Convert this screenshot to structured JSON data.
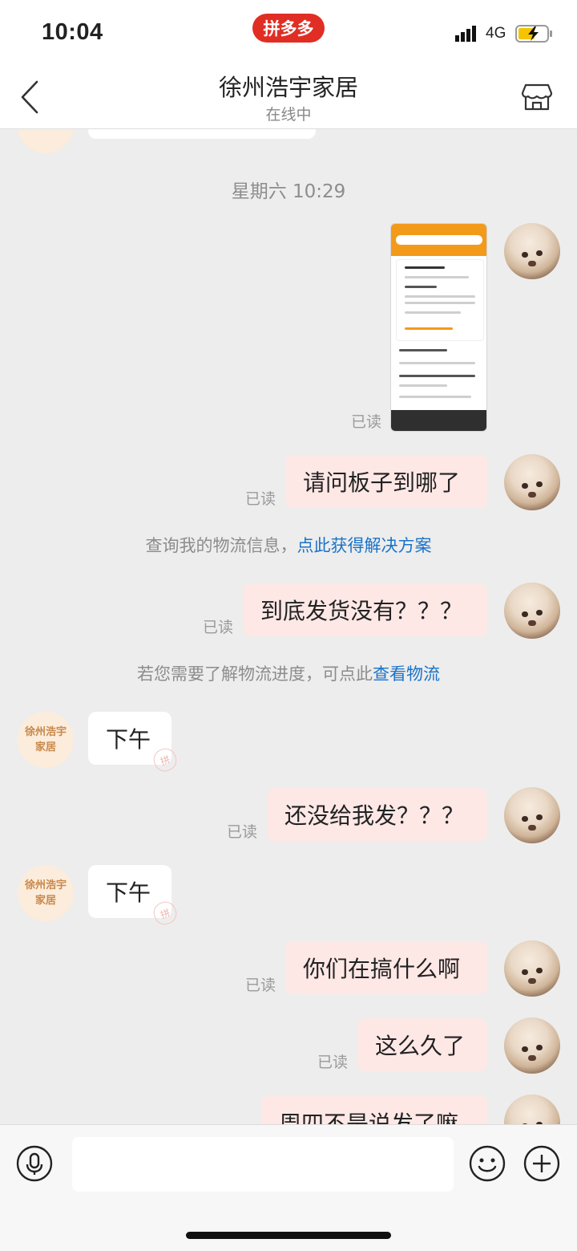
{
  "status_bar": {
    "time": "10:04",
    "app_badge": "拼多多",
    "network": "4G"
  },
  "header": {
    "title": "徐州浩宇家居",
    "subtitle": "在线中"
  },
  "chat": {
    "date_label": "星期六 10:29",
    "read_label": "已读",
    "messages": [
      {
        "text": "请问板子到哪了"
      },
      {
        "text": "到底发货没有？？？"
      },
      {
        "text": "下午"
      },
      {
        "text": "还没给我发？？？"
      },
      {
        "text": "下午"
      },
      {
        "text": "你们在搞什么啊"
      },
      {
        "text": "这么久了"
      },
      {
        "text": "周四不是说发了嘛"
      }
    ],
    "system_notices": [
      {
        "text": "查询我的物流信息，",
        "link": "点此获得解决方案"
      },
      {
        "text": "若您需要了解物流进度，可点此",
        "link": "查看物流"
      }
    ],
    "shop_avatar_text": [
      "徐州浩宇",
      "家居"
    ],
    "bubble_watermark": "拼"
  },
  "colors": {
    "accent": "#e02e24",
    "my_bubble": "#fde8e6",
    "link": "#1a73c9",
    "background": "#ededed"
  },
  "icons": [
    "back-icon",
    "store-icon",
    "voice-icon",
    "emoji-icon",
    "plus-icon",
    "signal-icon",
    "battery-icon"
  ]
}
